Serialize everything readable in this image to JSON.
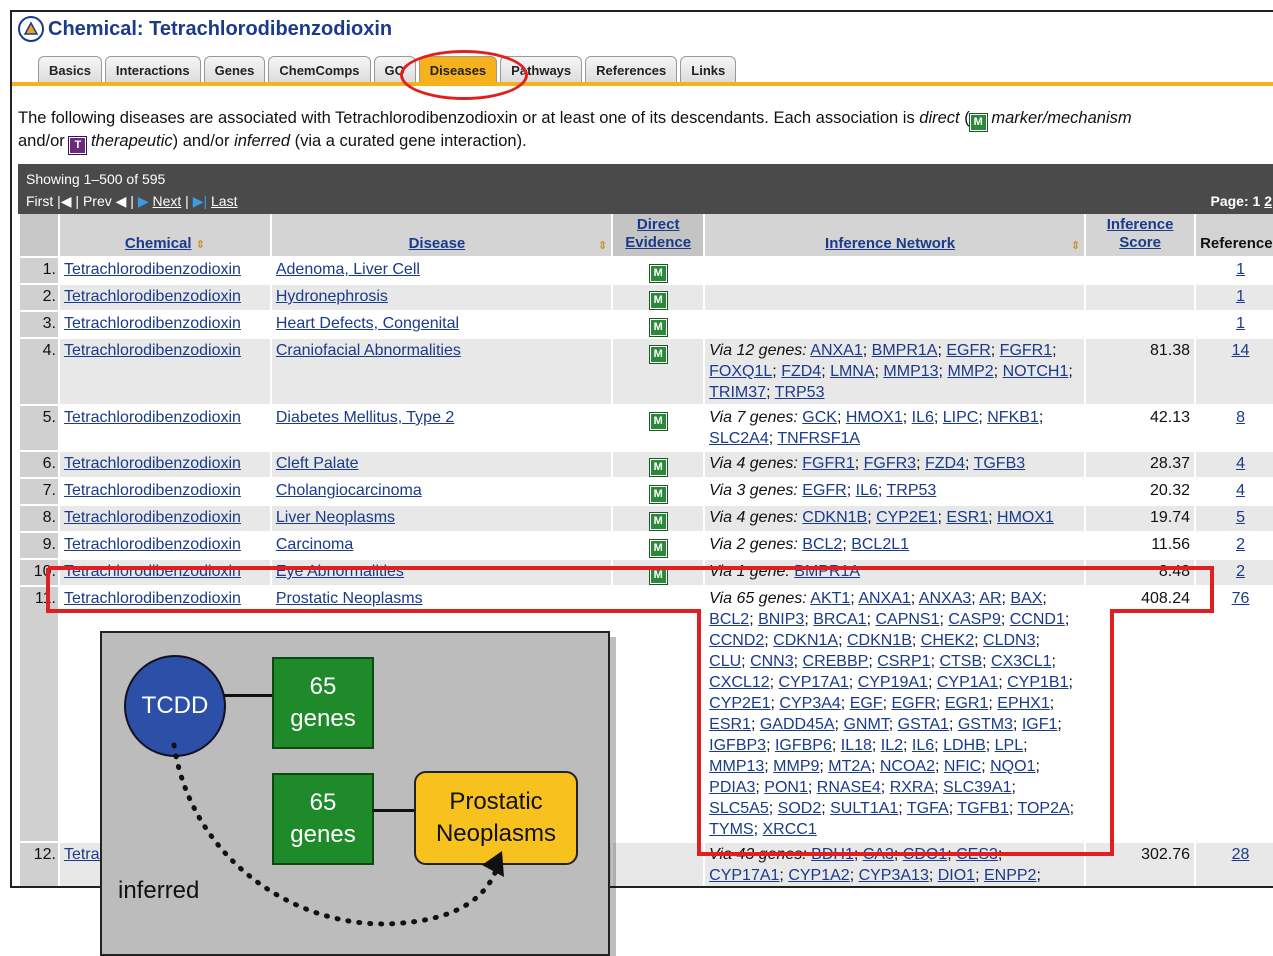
{
  "header": {
    "title": "Chemical: Tetrachlorodibenzodioxin"
  },
  "tabs": [
    "Basics",
    "Interactions",
    "Genes",
    "ChemComps",
    "GO",
    "Diseases",
    "Pathways",
    "References",
    "Links"
  ],
  "active_tab": "Diseases",
  "intro": {
    "p1": "The following diseases are associated with Tetrachlorodibenzodioxin or at least one of its descendants. Each association is ",
    "direct": "direct",
    "p2": " (",
    "marker": "marker/mechanism",
    "p3": "and/or ",
    "therapeutic": "therapeutic",
    "p4": ") and/or ",
    "inferred": "inferred",
    "p5": " (via a curated gene interaction)."
  },
  "pager": {
    "showing": "Showing 1–500 of 595",
    "first": "First",
    "prev": "Prev",
    "next": "Next",
    "last": "Last",
    "page_label": "Page:",
    "page_current": "1",
    "page_next": "2"
  },
  "table": {
    "headers": {
      "chemical": "Chemical",
      "disease": "Disease",
      "direct_l1": "Direct",
      "direct_l2": "Evidence",
      "network": "Inference Network",
      "score_l1": "Inference",
      "score_l2": "Score",
      "refs": "References"
    },
    "rows": [
      {
        "n": "1.",
        "chem": "Tetrachlorodibenzodioxin",
        "disease": "Adenoma, Liver Cell",
        "ev": "M",
        "via": "",
        "genes": "",
        "score": "",
        "refs": "1"
      },
      {
        "n": "2.",
        "chem": "Tetrachlorodibenzodioxin",
        "disease": "Hydronephrosis",
        "ev": "M",
        "via": "",
        "genes": "",
        "score": "",
        "refs": "1"
      },
      {
        "n": "3.",
        "chem": "Tetrachlorodibenzodioxin",
        "disease": "Heart Defects, Congenital",
        "ev": "M",
        "via": "",
        "genes": "",
        "score": "",
        "refs": "1"
      },
      {
        "n": "4.",
        "chem": "Tetrachlorodibenzodioxin",
        "disease": "Craniofacial Abnormalities",
        "ev": "M",
        "via": "Via 12 genes:",
        "genes": "ANXA1; BMPR1A; EGFR; FGFR1; FOXQ1L; FZD4; LMNA; MMP13; MMP2; NOTCH1; TRIM37; TRP53",
        "score": "81.38",
        "refs": "14"
      },
      {
        "n": "5.",
        "chem": "Tetrachlorodibenzodioxin",
        "disease": "Diabetes Mellitus, Type 2",
        "ev": "M",
        "via": "Via 7 genes:",
        "genes": "GCK; HMOX1; IL6; LIPC; NFKB1; SLC2A4; TNFRSF1A",
        "score": "42.13",
        "refs": "8"
      },
      {
        "n": "6.",
        "chem": "Tetrachlorodibenzodioxin",
        "disease": "Cleft Palate",
        "ev": "M",
        "via": "Via 4 genes:",
        "genes": "FGFR1; FGFR3; FZD4; TGFB3",
        "score": "28.37",
        "refs": "4"
      },
      {
        "n": "7.",
        "chem": "Tetrachlorodibenzodioxin",
        "disease": "Cholangiocarcinoma",
        "ev": "M",
        "via": "Via 3 genes:",
        "genes": "EGFR; IL6; TRP53",
        "score": "20.32",
        "refs": "4"
      },
      {
        "n": "8.",
        "chem": "Tetrachlorodibenzodioxin",
        "disease": "Liver Neoplasms",
        "ev": "M",
        "via": "Via 4 genes:",
        "genes": "CDKN1B; CYP2E1; ESR1; HMOX1",
        "score": "19.74",
        "refs": "5"
      },
      {
        "n": "9.",
        "chem": "Tetrachlorodibenzodioxin",
        "disease": "Carcinoma",
        "ev": "M",
        "via": "Via 2 genes:",
        "genes": "BCL2; BCL2L1",
        "score": "11.56",
        "refs": "2"
      },
      {
        "n": "10.",
        "chem": "Tetrachlorodibenzodioxin",
        "disease": "Eye Abnormalities",
        "ev": "M",
        "via": "Via 1 gene:",
        "genes": "BMPR1A",
        "score": "8.48",
        "refs": "2"
      },
      {
        "n": "11.",
        "chem": "Tetrachlorodibenzodioxin",
        "disease": "Prostatic Neoplasms",
        "ev": "",
        "via": "Via 65 genes:",
        "genes": "AKT1; ANXA1; ANXA3; AR; BAX; BCL2; BNIP3; BRCA1; CAPNS1; CASP9; CCND1; CCND2; CDKN1A; CDKN1B; CHEK2; CLDN3; CLU; CNN3; CREBBP; CSRP1; CTSB; CX3CL1; CXCL12; CYP17A1; CYP19A1; CYP1A1; CYP1B1; CYP2E1; CYP3A4; EGF; EGFR; EGR1; EPHX1; ESR1; GADD45A; GNMT; GSTA1; GSTM3; IGF1; IGFBP3; IGFBP6; IL18; IL2; IL6; LDHB; LPL; MMP13; MMP9; MT2A; NCOA2; NFIC; NQO1; PDIA3; PON1; RNASE4; RXRA; SLC39A1; SLC5A5; SOD2; SULT1A1; TGFA; TGFB1; TOP2A; TYMS; XRCC1",
        "score": "408.24",
        "refs": "76"
      },
      {
        "n": "12.",
        "chem": "Tetrachlorodibenzodioxin",
        "disease": "",
        "ev": "",
        "via": "Via 43 genes:",
        "genes": "BDH1; CA3; CDO1; CES3; CYP17A1; CYP1A2; CYP3A13; DIO1; ENPP2;",
        "score": "302.76",
        "refs": "28"
      }
    ]
  },
  "inset": {
    "tcdd": "TCDD",
    "genes_top_1": "65",
    "genes_top_2": "genes",
    "genes_bot_1": "65",
    "genes_bot_2": "genes",
    "disease_1": "Prostatic",
    "disease_2": "Neoplasms",
    "inferred": "inferred"
  },
  "colors": {
    "tab_active": "#f5b21c",
    "highlight": "#e02020",
    "tcdd": "#2c4fa8",
    "genes": "#1f8a2a",
    "disease": "#f7c21e"
  }
}
